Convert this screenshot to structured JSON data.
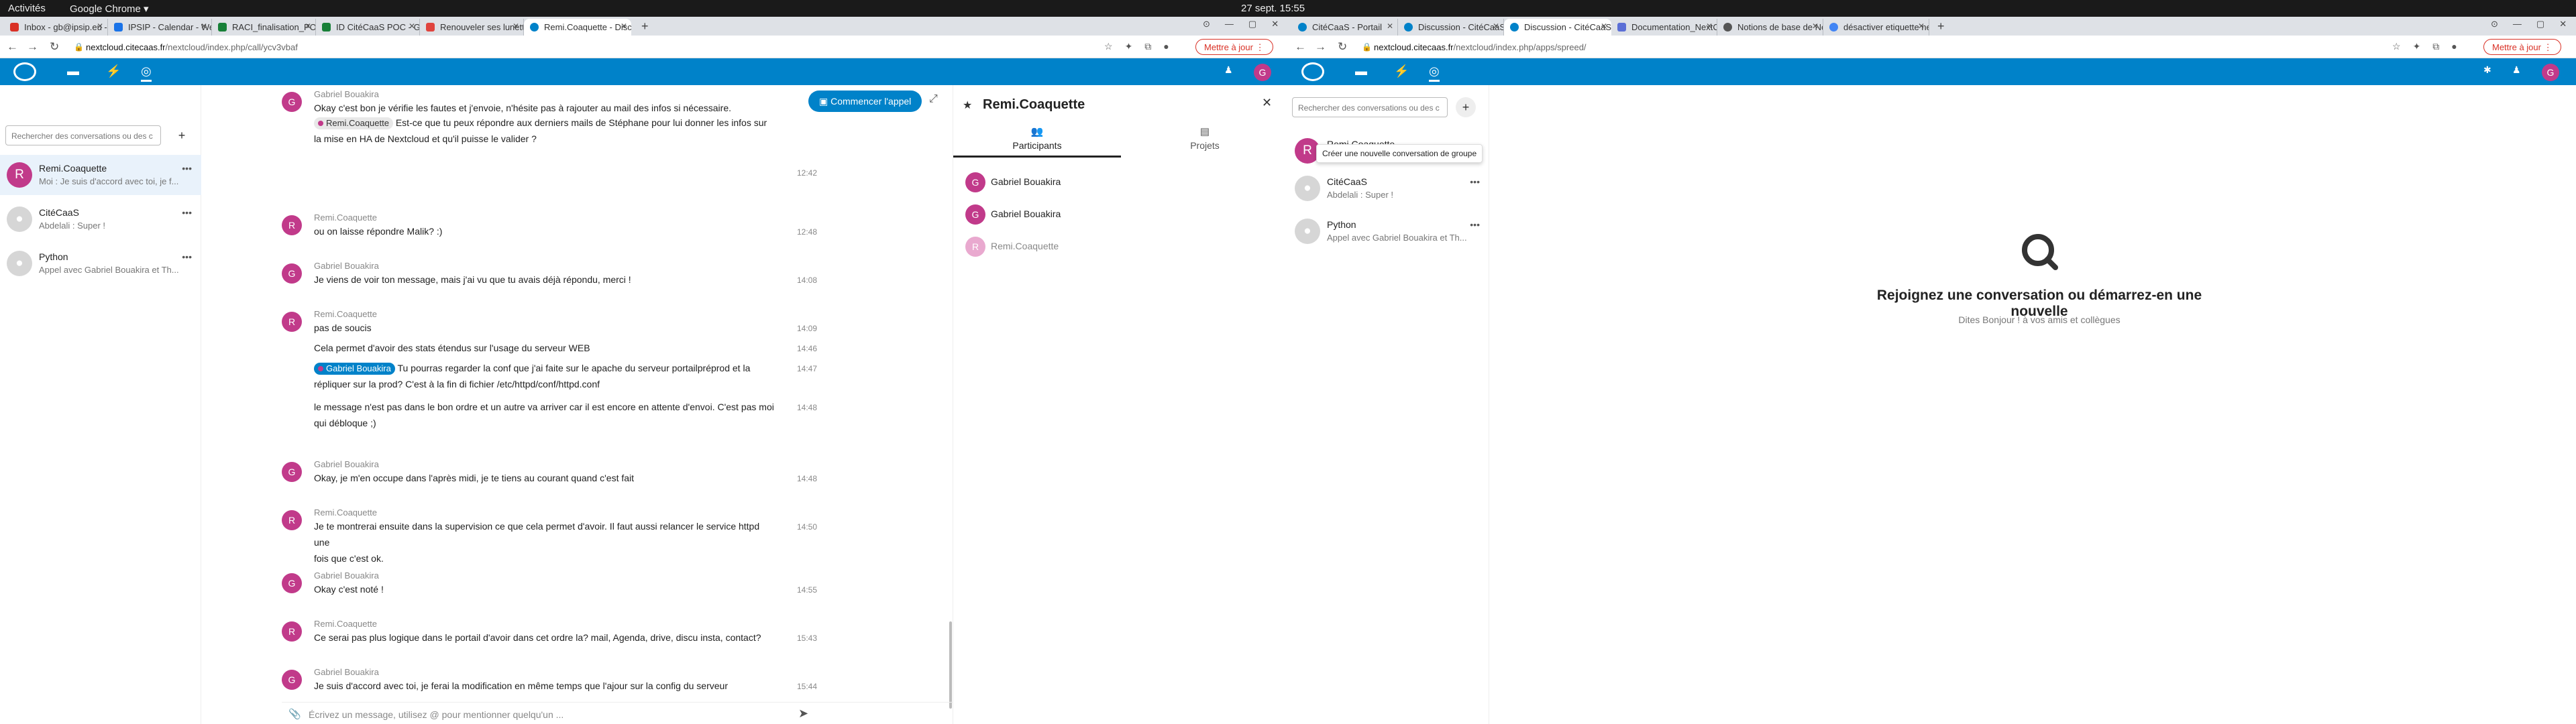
{
  "topbar": {
    "activities": "Activités",
    "app": "Google Chrome ▾",
    "clock": "27 sept.  15:55"
  },
  "left": {
    "tabs": [
      "Inbox - gb@ipsip.eu - IPSIP",
      "IPSIP - Calendar - Week of",
      "RACI_finalisation_POC_C",
      "ID CitéCaaS POC - Google",
      "Renouveler ses lunettes",
      "Remi.Coaquette - Discuss"
    ],
    "url_host": "nextcloud.citecaas.fr",
    "url_path": "/nextcloud/index.php/call/ycv3vbaf",
    "update": "Mettre à jour",
    "search_placeholder": "Rechercher des conversations ou des c",
    "conversations": [
      {
        "initial": "R",
        "name": "Remi.Coaquette",
        "snippet": "Moi : Je suis d'accord avec toi, je f...",
        "color": "#c13a8a"
      },
      {
        "initial": "",
        "name": "CitéCaaS",
        "snippet": "Abdelali : Super !",
        "color": "#d6d6d6"
      },
      {
        "initial": "",
        "name": "Python",
        "snippet": "Appel avec Gabriel Bouakira et Th...",
        "color": "#d6d6d6"
      }
    ],
    "call_button": "Commencer l'appel",
    "messages": [
      {
        "initial": "G",
        "author": "Gabriel Bouakira",
        "color": "#c13a8a",
        "lines": [
          {
            "t": "Okay c'est bon je vérifie les fautes et j'envoie, n'hésite pas à rajouter au mail des infos si nécessaire.",
            "time": ""
          },
          {
            "mention": "Remi.Coaquette",
            "me": false,
            "t": " Est-ce que tu peux répondre aux derniers mails de Stéphane pour lui donner les infos sur",
            "t2": "la mise en HA de Nextcloud et qu'il puisse le valider ?",
            "time": "12:42"
          }
        ]
      },
      {
        "initial": "R",
        "author": "Remi.Coaquette",
        "color": "#c13a8a",
        "lines": [
          {
            "t": "ou on laisse répondre Malik? :)",
            "time": "12:48"
          }
        ]
      },
      {
        "initial": "G",
        "author": "Gabriel Bouakira",
        "color": "#c13a8a",
        "lines": [
          {
            "t": "Je viens de voir ton message, mais j'ai vu que tu avais déjà répondu, merci !",
            "time": "14:08"
          }
        ]
      },
      {
        "initial": "R",
        "author": "Remi.Coaquette",
        "color": "#c13a8a",
        "lines": [
          {
            "t": "pas de soucis",
            "time": "14:09"
          },
          {
            "t": "Cela permet d'avoir des stats étendus sur l'usage du serveur WEB",
            "time": "14:46"
          },
          {
            "mention": "Gabriel Bouakira",
            "me": true,
            "t": " Tu pourras regarder la conf que j'ai faite sur le apache du serveur portailpréprod et la",
            "t2": "répliquer sur la prod? C'est à la fin di fichier /etc/httpd/conf/httpd.conf",
            "time": "14:47"
          },
          {
            "t": "le message n'est pas dans le bon ordre et un autre va arriver car il est encore en attente d'envoi. C'est pas moi",
            "t2": "qui débloque ;)",
            "time": "14:48"
          }
        ]
      },
      {
        "initial": "G",
        "author": "Gabriel Bouakira",
        "color": "#c13a8a",
        "lines": [
          {
            "t": "Okay, je m'en occupe dans l'après midi, je te tiens au courant quand c'est fait",
            "time": "14:48"
          }
        ]
      },
      {
        "initial": "R",
        "author": "Remi.Coaquette",
        "color": "#c13a8a",
        "lines": [
          {
            "t": "Je te montrerai ensuite dans la supervision ce que cela permet d'avoir. Il faut aussi relancer le service httpd une",
            "t2": "fois que c'est ok.",
            "time": "14:50"
          }
        ]
      },
      {
        "initial": "G",
        "author": "Gabriel Bouakira",
        "color": "#c13a8a",
        "lines": [
          {
            "t": "Okay c'est noté !",
            "time": "14:55"
          }
        ]
      },
      {
        "initial": "R",
        "author": "Remi.Coaquette",
        "color": "#c13a8a",
        "lines": [
          {
            "t": "Ce serai pas plus logique dans le portail d'avoir dans cet ordre la? mail, Agenda, drive, discu insta, contact?",
            "time": "15:43"
          }
        ]
      },
      {
        "initial": "G",
        "author": "Gabriel Bouakira",
        "color": "#c13a8a",
        "lines": [
          {
            "t": "Je suis d'accord avec toi, je ferai la modification en même temps que l'ajour sur la config du serveur",
            "time": "15:44"
          }
        ]
      }
    ],
    "composer_placeholder": "Écrivez un message, utilisez @ pour mentionner quelqu'un ...",
    "sidebar": {
      "title": "Remi.Coaquette",
      "tab_participants": "Participants",
      "tab_projects": "Projets",
      "participants": [
        {
          "initial": "G",
          "name": "Gabriel Bouakira"
        },
        {
          "initial": "G",
          "name": "Gabriel Bouakira"
        },
        {
          "initial": "R",
          "name": "Remi.Coaquette"
        }
      ]
    }
  },
  "right": {
    "tabs": [
      "CitéCaaS - Portail",
      "Discussion - CitéCaaS Dri",
      "Discussion - CitéCaaS Dri",
      "Documentation_NextClo",
      "Notions de base de Nexto",
      "désactiver etiquette next"
    ],
    "url_host": "nextcloud.citecaas.fr",
    "url_path": "/nextcloud/index.php/apps/spreed/",
    "update": "Mettre à jour",
    "search_placeholder": "Rechercher des conversations ou des c",
    "tooltip": "Créer une nouvelle conversation de groupe",
    "empty_title": "Rejoignez une conversation ou démarrez-en une nouvelle",
    "empty_sub": "Dites Bonjour ! à vos amis et collègues"
  },
  "colors": {
    "nextcloud_blue": "#0082c9",
    "avatar_pink": "#c13a8a",
    "topbar": "#1a1a1a"
  }
}
